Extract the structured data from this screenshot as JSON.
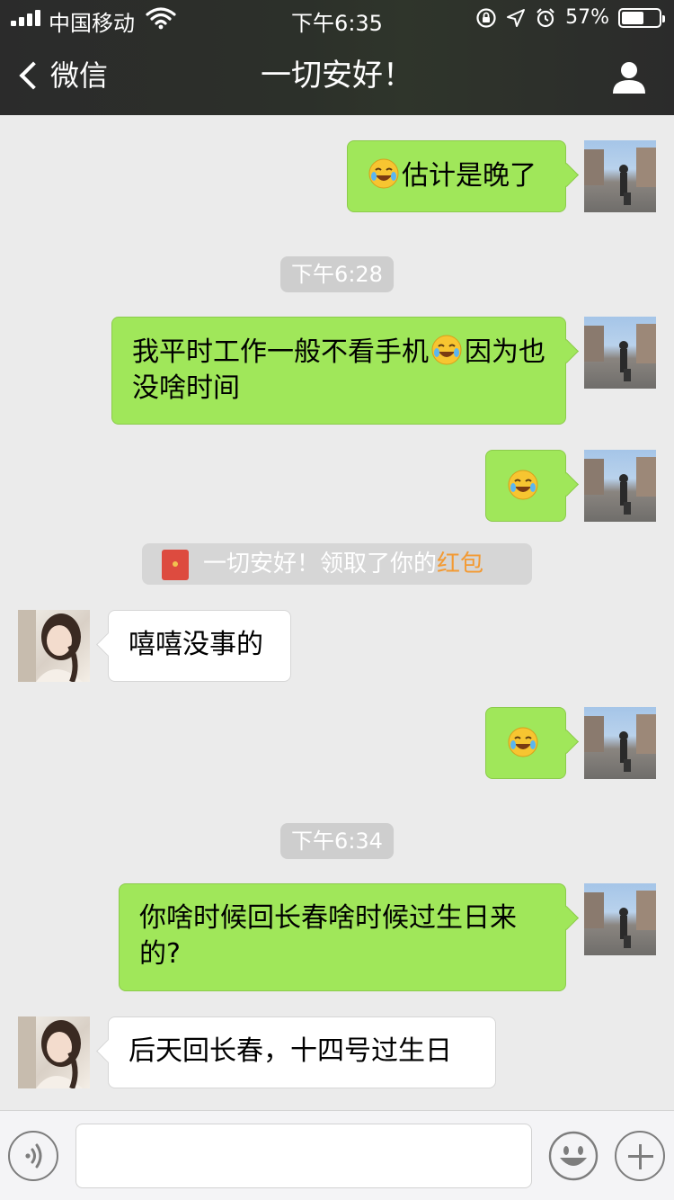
{
  "status_bar": {
    "carrier": "中国移动",
    "time": "下午6:35",
    "battery": "57%",
    "battery_level": 0.57
  },
  "nav": {
    "back_label": "微信",
    "title": "一切安好！",
    "icons": [
      "chevron-left-icon",
      "user-icon"
    ]
  },
  "messages": [
    {
      "text": "估计是晚了",
      "emoji": "tears-of-joy-emoji"
    },
    {
      "time": "下午6:28"
    },
    {
      "before": "我平时工作一般不看手机",
      "after": "因为也没啥时间",
      "emoji": "tears-of-joy-emoji"
    },
    {
      "emoji": "tears-of-joy-emoji"
    },
    {
      "system": {
        "pre": "一切安好！领取了你的",
        "link": "红包"
      }
    },
    {
      "text": "嘻嘻没事的"
    },
    {
      "emoji": "tears-of-joy-emoji"
    },
    {
      "time": "下午6:34"
    },
    {
      "text": "你啥时候回长春啥时候过生日来的?"
    },
    {
      "text": "后天回长春，十四号过生日"
    }
  ],
  "colors": {
    "my_bubble": "#a0e75a",
    "their_bubble": "#ffffff",
    "chat_bg": "#ebebeb",
    "header_bg": "#2b2b2b",
    "system_link": "#f39a33"
  },
  "input": {
    "placeholder": "",
    "icons": [
      "voice-icon",
      "emoji-icon",
      "plus-icon"
    ]
  }
}
